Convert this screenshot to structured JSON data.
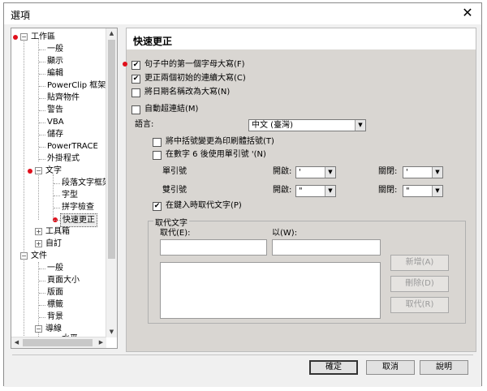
{
  "window": {
    "title": "選項"
  },
  "tree": {
    "items": [
      {
        "label": "工作區"
      },
      {
        "label": "一般"
      },
      {
        "label": "顯示"
      },
      {
        "label": "編輯"
      },
      {
        "label": "PowerClip 框架"
      },
      {
        "label": "貼齊物件"
      },
      {
        "label": "警告"
      },
      {
        "label": "VBA"
      },
      {
        "label": "儲存"
      },
      {
        "label": "PowerTRACE"
      },
      {
        "label": "外掛程式"
      },
      {
        "label": "文字"
      },
      {
        "label": "段落文字框架"
      },
      {
        "label": "字型"
      },
      {
        "label": "拼字檢查"
      },
      {
        "label": "快速更正"
      },
      {
        "label": "工具箱"
      },
      {
        "label": "自訂"
      },
      {
        "label": "文件"
      },
      {
        "label": "一般"
      },
      {
        "label": "頁面大小"
      },
      {
        "label": "版面"
      },
      {
        "label": "標籤"
      },
      {
        "label": "背景"
      },
      {
        "label": "導線"
      },
      {
        "label": "水平"
      }
    ]
  },
  "panel": {
    "title": "快速更正",
    "options": {
      "capitalize_first": "句子中的第一個字母大寫(F)",
      "correct_two_initial": "更正兩個初始的連續大寫(C)",
      "capitalize_days": "將日期名稱改為大寫(N)",
      "auto_hyperlink": "自動超連結(M)"
    },
    "language_label": "語言:",
    "language_value": "中文 (臺灣)",
    "quote_brackets": "將中括號變更為印刷體括號(T)",
    "single_after_digit": "在數字 6 後使用單引號 '(N)",
    "single_quote_label": "單引號",
    "double_quote_label": "雙引號",
    "open_label": "開啟:",
    "close_label": "關閉:",
    "single_open": "'",
    "single_close": "'",
    "double_open": "\"",
    "double_close": "\"",
    "replace_while_typing": "在鍵入時取代文字(P)",
    "replace_group_title": "取代文字",
    "replace_label": "取代(E):",
    "with_label": "以(W):",
    "add_button": "新增(A)",
    "delete_button": "刪除(D)",
    "replace_button": "取代(R)"
  },
  "footer": {
    "ok": "確定",
    "cancel": "取消",
    "help": "說明"
  },
  "colors": {
    "annotation_dot": "#e0101c"
  }
}
